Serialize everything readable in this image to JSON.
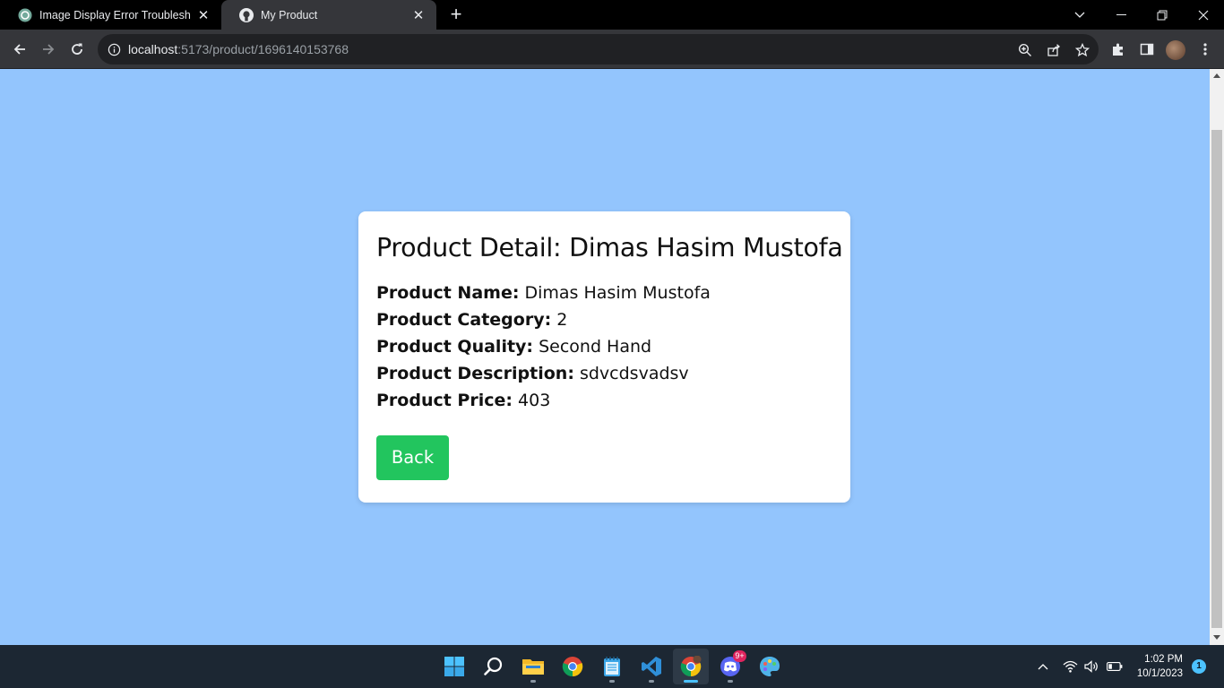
{
  "browser": {
    "tabs": [
      {
        "title": "Image Display Error Troubleshoo",
        "favicon": "chatgpt-icon",
        "active": false
      },
      {
        "title": "My Product",
        "favicon": "github-icon",
        "active": true
      }
    ],
    "address": {
      "host": "localhost",
      "rest": ":5173/product/1696140153768"
    }
  },
  "product": {
    "heading": "Product Detail: Dimas Hasim Mustofa",
    "fields": [
      {
        "label": "Product Name:",
        "value": "Dimas Hasim Mustofa"
      },
      {
        "label": "Product Category:",
        "value": "2"
      },
      {
        "label": "Product Quality:",
        "value": "Second Hand"
      },
      {
        "label": "Product Description:",
        "value": "sdvcdsvadsv"
      },
      {
        "label": "Product Price:",
        "value": "403"
      }
    ],
    "back_label": "Back"
  },
  "taskbar": {
    "apps": [
      "start-icon",
      "search-icon",
      "file-explorer-icon",
      "chrome-icon",
      "notepad-icon",
      "vscode-icon",
      "chrome-profile-icon",
      "discord-icon",
      "paint-icon"
    ],
    "discord_badge": "9+",
    "time": "1:02 PM",
    "date": "10/1/2023",
    "notifications": "1"
  },
  "colors": {
    "page_bg": "#93c5fd",
    "button_bg": "#22c55e",
    "card_bg": "#ffffff"
  }
}
